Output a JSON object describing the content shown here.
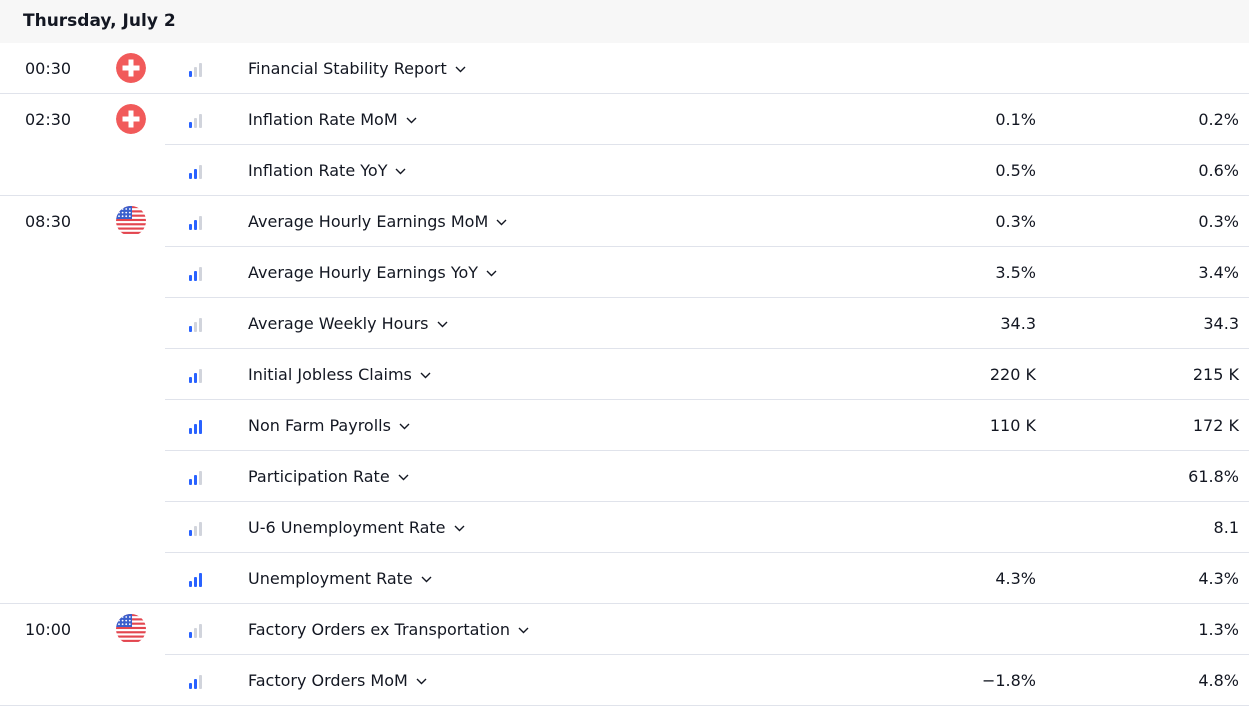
{
  "day_header": "Thursday, July 2",
  "flag_colors": {
    "switzerland": "#f15a5a",
    "us_red": "#e3464f",
    "us_blue": "#3a5fcd"
  },
  "groups": [
    {
      "time": "00:30",
      "country": "switzerland",
      "events": [
        {
          "title": "Financial Stability Report",
          "importance": 1,
          "col1": "",
          "col2": ""
        }
      ]
    },
    {
      "time": "02:30",
      "country": "switzerland",
      "events": [
        {
          "title": "Inflation Rate MoM",
          "importance": 1,
          "col1": "0.1%",
          "col2": "0.2%"
        },
        {
          "title": "Inflation Rate YoY",
          "importance": 2,
          "col1": "0.5%",
          "col2": "0.6%"
        }
      ]
    },
    {
      "time": "08:30",
      "country": "us",
      "events": [
        {
          "title": "Average Hourly Earnings MoM",
          "importance": 2,
          "col1": "0.3%",
          "col2": "0.3%"
        },
        {
          "title": "Average Hourly Earnings YoY",
          "importance": 2,
          "col1": "3.5%",
          "col2": "3.4%"
        },
        {
          "title": "Average Weekly Hours",
          "importance": 1,
          "col1": "34.3",
          "col2": "34.3"
        },
        {
          "title": "Initial Jobless Claims",
          "importance": 2,
          "col1": "220 K",
          "col2": "215 K"
        },
        {
          "title": "Non Farm Payrolls",
          "importance": 3,
          "col1": "110 K",
          "col2": "172 K"
        },
        {
          "title": "Participation Rate",
          "importance": 2,
          "col1": "",
          "col2": "61.8%"
        },
        {
          "title": "U-6 Unemployment Rate",
          "importance": 1,
          "col1": "",
          "col2": "8.1"
        },
        {
          "title": "Unemployment Rate",
          "importance": 3,
          "col1": "4.3%",
          "col2": "4.3%"
        }
      ]
    },
    {
      "time": "10:00",
      "country": "us",
      "events": [
        {
          "title": "Factory Orders ex Transportation",
          "importance": 1,
          "col1": "",
          "col2": "1.3%"
        },
        {
          "title": "Factory Orders MoM",
          "importance": 2,
          "col1": "−1.8%",
          "col2": "4.8%"
        }
      ]
    }
  ]
}
